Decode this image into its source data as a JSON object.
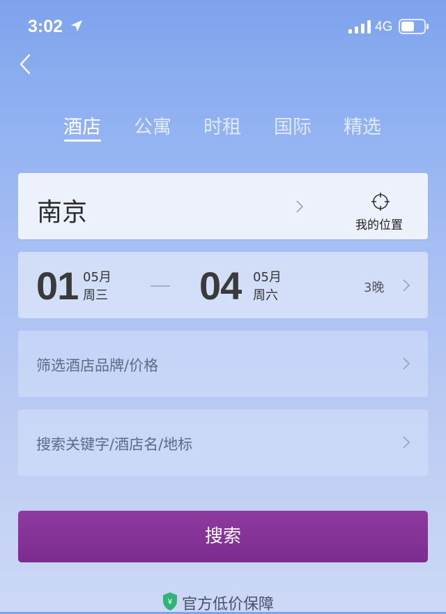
{
  "status_bar": {
    "time": "3:02",
    "network": "4G",
    "icons": [
      "location-arrow-icon",
      "signal-icon",
      "battery-icon"
    ]
  },
  "nav": {
    "back_icon": "chevron-left-icon"
  },
  "tabs": [
    {
      "label": "酒店",
      "active": true
    },
    {
      "label": "公寓",
      "active": false
    },
    {
      "label": "时租",
      "active": false
    },
    {
      "label": "国际",
      "active": false
    },
    {
      "label": "精选",
      "active": false
    }
  ],
  "city": {
    "name": "南京",
    "location_label": "我的位置"
  },
  "dates": {
    "checkin": {
      "day": "01",
      "month": "05月",
      "weekday": "周三"
    },
    "checkout": {
      "day": "04",
      "month": "05月",
      "weekday": "周六"
    },
    "nights": "3晚"
  },
  "filter": {
    "placeholder": "筛选酒店品牌/价格"
  },
  "keyword": {
    "placeholder": "搜索关键字/酒店名/地标"
  },
  "search_button": {
    "label": "搜索"
  },
  "guarantee": {
    "text": "官方低价保障",
    "symbol": "¥"
  },
  "colors": {
    "accent": "#7e2e90",
    "shield": "#2fb37a"
  }
}
